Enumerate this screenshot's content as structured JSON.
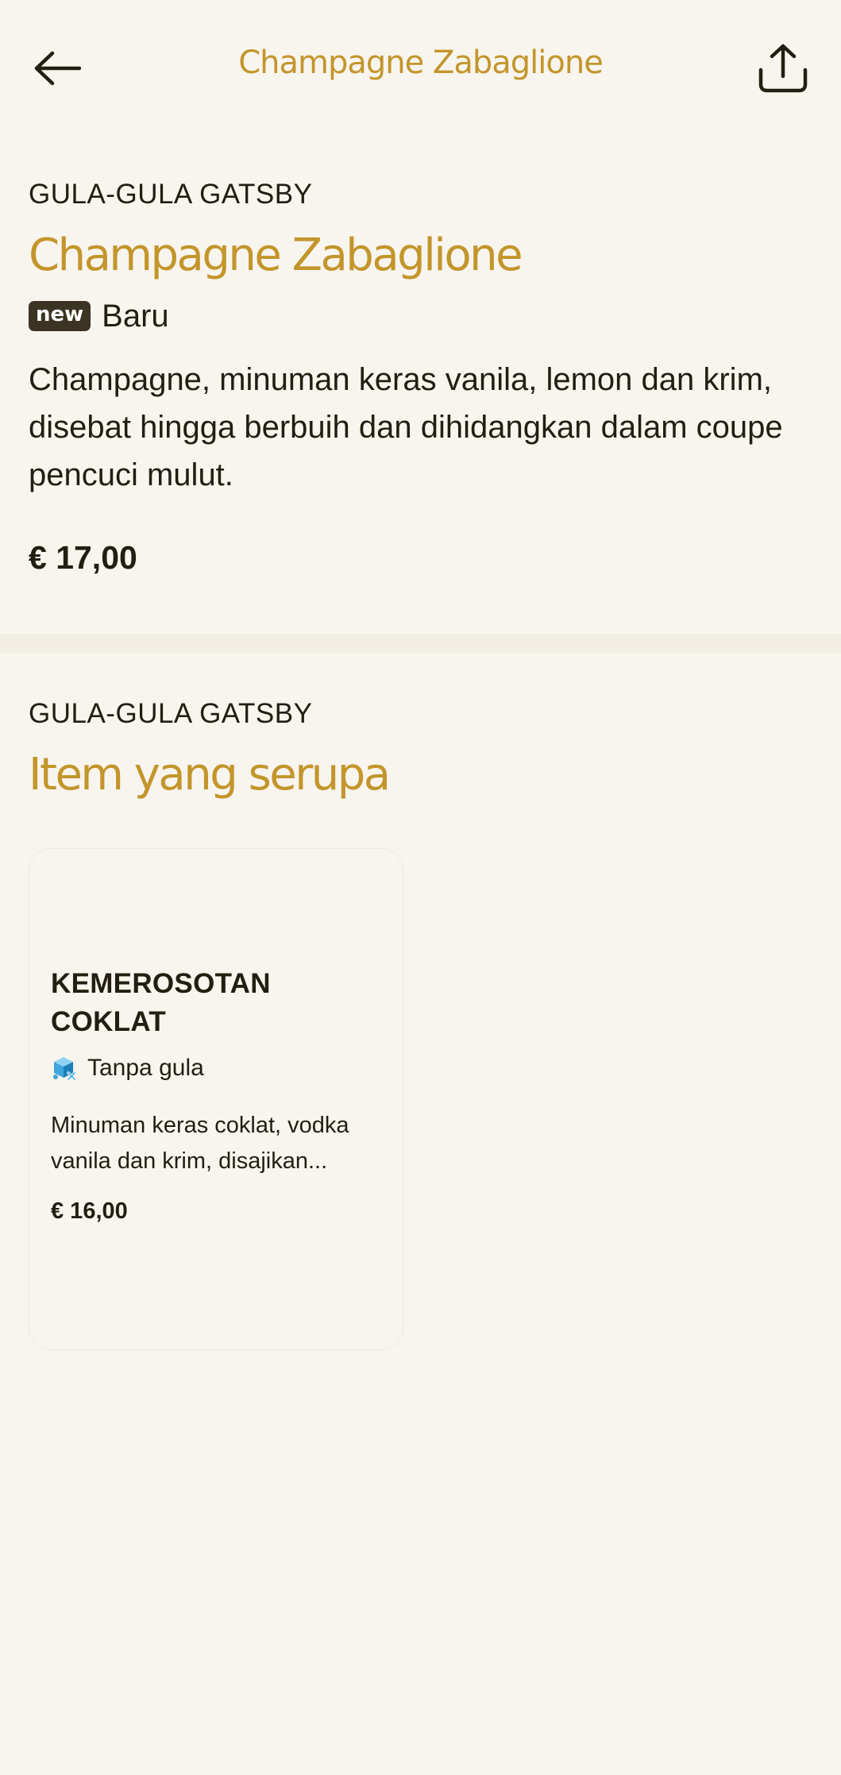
{
  "header": {
    "title": "Champagne Zabaglione",
    "back_icon": "arrow-left-icon",
    "share_icon": "share-icon"
  },
  "product": {
    "brand": "GULA-GULA GATSBY",
    "title": "Champagne Zabaglione",
    "badge": "new",
    "badge_label": "Baru",
    "description": "Champagne, minuman keras vanila, lemon dan krim, disebat hingga berbuih dan dihidangkan dalam coupe pencuci mulut.",
    "price": "€ 17,00"
  },
  "similar": {
    "brand": "GULA-GULA GATSBY",
    "title": "Item yang serupa",
    "items": [
      {
        "name": "KEMEROSOTAN COKLAT",
        "tag_icon": "sugar-free-icon",
        "tag_label": "Tanpa gula",
        "description": "Minuman keras coklat, vodka vanila dan krim, disajikan...",
        "price": "€ 16,00"
      }
    ]
  },
  "colors": {
    "background": "#f8f5ef",
    "accent": "#c3952a",
    "text": "#221e12",
    "badge": "#3b3422",
    "sugar_icon": "#4fb4e6"
  }
}
